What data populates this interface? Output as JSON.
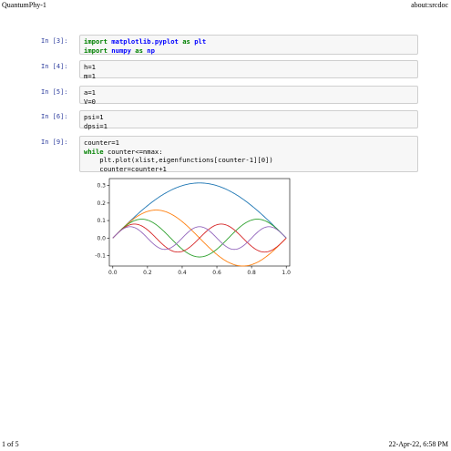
{
  "header": {
    "left": "QuantumPhy-1",
    "right": "about:srcdoc"
  },
  "footer": {
    "left": "1 of 5",
    "right": "22-Apr-22, 6:58 PM"
  },
  "cells": [
    {
      "prompt": "In [3]:",
      "lines": [
        [
          {
            "t": "import",
            "k": "kw"
          },
          {
            "t": " "
          },
          {
            "t": "matplotlib.pyplot",
            "k": "mod"
          },
          {
            "t": " "
          },
          {
            "t": "as",
            "k": "kw"
          },
          {
            "t": " "
          },
          {
            "t": "plt",
            "k": "mod"
          }
        ],
        [
          {
            "t": "import",
            "k": "kw"
          },
          {
            "t": " "
          },
          {
            "t": "numpy",
            "k": "mod"
          },
          {
            "t": " "
          },
          {
            "t": "as",
            "k": "kw"
          },
          {
            "t": " "
          },
          {
            "t": "np",
            "k": "mod"
          }
        ]
      ]
    },
    {
      "prompt": "In [4]:",
      "lines": [
        [
          {
            "t": "h=1"
          }
        ],
        [
          {
            "t": "m=1"
          }
        ]
      ]
    },
    {
      "prompt": "In [5]:",
      "lines": [
        [
          {
            "t": "a=1"
          }
        ],
        [
          {
            "t": "V=0"
          }
        ]
      ]
    },
    {
      "prompt": "In [6]:",
      "lines": [
        [
          {
            "t": "psi=1"
          }
        ],
        [
          {
            "t": "dpsi=1"
          }
        ]
      ]
    },
    {
      "prompt": "In [9]:",
      "lines": [
        [
          {
            "t": "counter=1"
          }
        ],
        [
          {
            "t": "while",
            "k": "kw"
          },
          {
            "t": " counter<=nmax:"
          }
        ],
        [
          {
            "t": "    plt.plot(xlist,eigenfunctions[counter-1][0])"
          }
        ],
        [
          {
            "t": "    counter=counter+1"
          }
        ]
      ]
    }
  ],
  "chart_data": {
    "type": "line",
    "xlim": [
      -0.02,
      1.02
    ],
    "ylim": [
      -0.16,
      0.34
    ],
    "xticks": [
      "0.0",
      "0.2",
      "0.4",
      "0.6",
      "0.8",
      "1.0"
    ],
    "yticks": [
      "-0.1",
      "0.0",
      "0.1",
      "0.2",
      "0.3"
    ],
    "grid": false,
    "series": [
      {
        "n": 1,
        "amplitude": 0.315,
        "color": "#1f77b4"
      },
      {
        "n": 2,
        "amplitude": 0.16,
        "color": "#ff7f0e"
      },
      {
        "n": 3,
        "amplitude": 0.108,
        "color": "#2ca02c"
      },
      {
        "n": 4,
        "amplitude": 0.08,
        "color": "#d62728"
      },
      {
        "n": 5,
        "amplitude": 0.065,
        "color": "#9467bd"
      }
    ]
  }
}
